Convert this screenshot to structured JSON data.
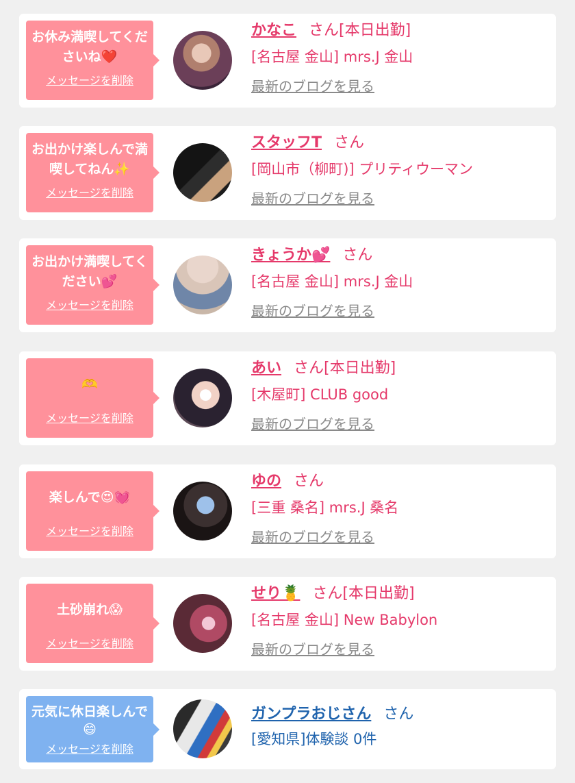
{
  "colors": {
    "accent_pink": "#e5396a",
    "bubble_pink": "#ff919b",
    "bubble_blue": "#7fb2f0",
    "accent_blue": "#1f63ad"
  },
  "entries": [
    {
      "message": "お休み満喫してくださいね❤️",
      "delete_label": "メッセージを削除",
      "name": "かなこ",
      "suffix": "さん[本日出勤]",
      "shop": "[名古屋 金山] mrs.J 金山",
      "blog_label": "最新のブログを見る",
      "avatar": "profile-photo"
    },
    {
      "message": "お出かけ楽しんで満喫してねん✨",
      "delete_label": "メッセージを削除",
      "name": "スタッフT",
      "suffix": "さん",
      "shop": "[岡山市（柳町)] プリティウーマン",
      "blog_label": "最新のブログを見る",
      "avatar": "profile-photo"
    },
    {
      "message": "お出かけ満喫してください💕",
      "delete_label": "メッセージを削除",
      "name": "きょうか💕",
      "suffix": "さん",
      "shop": "[名古屋 金山] mrs.J 金山",
      "blog_label": "最新のブログを見る",
      "avatar": "profile-photo"
    },
    {
      "message": "🫶",
      "delete_label": "メッセージを削除",
      "name": "あい",
      "suffix": "さん[本日出勤]",
      "shop": "[木屋町] CLUB good",
      "blog_label": "最新のブログを見る",
      "avatar": "profile-photo"
    },
    {
      "message": "楽しんで😍💓",
      "delete_label": "メッセージを削除",
      "name": "ゆの",
      "suffix": "さん",
      "shop": "[三重 桑名] mrs.J 桑名",
      "blog_label": "最新のブログを見る",
      "avatar": "profile-photo"
    },
    {
      "message": "土砂崩れ😱",
      "delete_label": "メッセージを削除",
      "name": "せり🍍",
      "suffix": "さん[本日出勤]",
      "shop": "[名古屋 金山] New Babylon",
      "blog_label": "最新のブログを見る",
      "avatar": "profile-photo"
    },
    {
      "message": "元気に休日楽しんで😄",
      "delete_label": "メッセージを削除",
      "name": "ガンプラおじさん",
      "suffix": "さん",
      "shop": "[愛知県]体験談 0件",
      "avatar": "profile-photo"
    }
  ]
}
